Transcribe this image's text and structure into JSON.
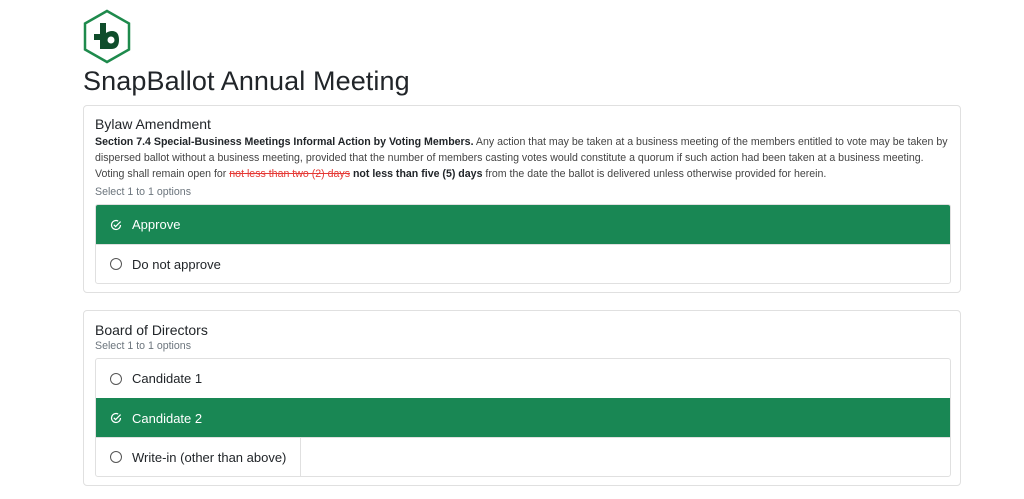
{
  "app": {
    "title": "SnapBallot Annual Meeting",
    "logo_icon": "snapballot-logo-icon"
  },
  "colors": {
    "selected": "#198754",
    "logo_green": "#1e8a4c",
    "logo_dark": "#0f4d2b",
    "strike": "#e53935"
  },
  "questions": [
    {
      "title": "Bylaw Amendment",
      "text": {
        "heading": "Section 7.4 Special-Business Meetings Informal Action by Voting Members.",
        "body_1": " Any action that may be taken at a business meeting of the members entitled to vote may be taken by dispersed ballot without a business meeting, provided that the number of members casting votes would constitute a quorum if such action had been taken at a business meeting. Voting shall remain open for ",
        "removed": "not less than two (2) days",
        "added": " not less than five (5) days",
        "body_2": " from the date the ballot is delivered unless otherwise provided for herein."
      },
      "hint": "Select 1 to 1 options",
      "options": [
        {
          "label": "Approve",
          "selected": true,
          "icon": "check-circle-icon"
        },
        {
          "label": "Do not approve",
          "selected": false,
          "icon": "radio-icon"
        }
      ]
    },
    {
      "title": "Board of Directors",
      "hint": "Select 1 to 1 options",
      "options": [
        {
          "label": "Candidate 1",
          "selected": false,
          "icon": "radio-icon"
        },
        {
          "label": "Candidate 2",
          "selected": true,
          "icon": "check-circle-icon"
        },
        {
          "label": "Write-in (other than above)",
          "selected": false,
          "icon": "radio-icon"
        }
      ]
    }
  ]
}
